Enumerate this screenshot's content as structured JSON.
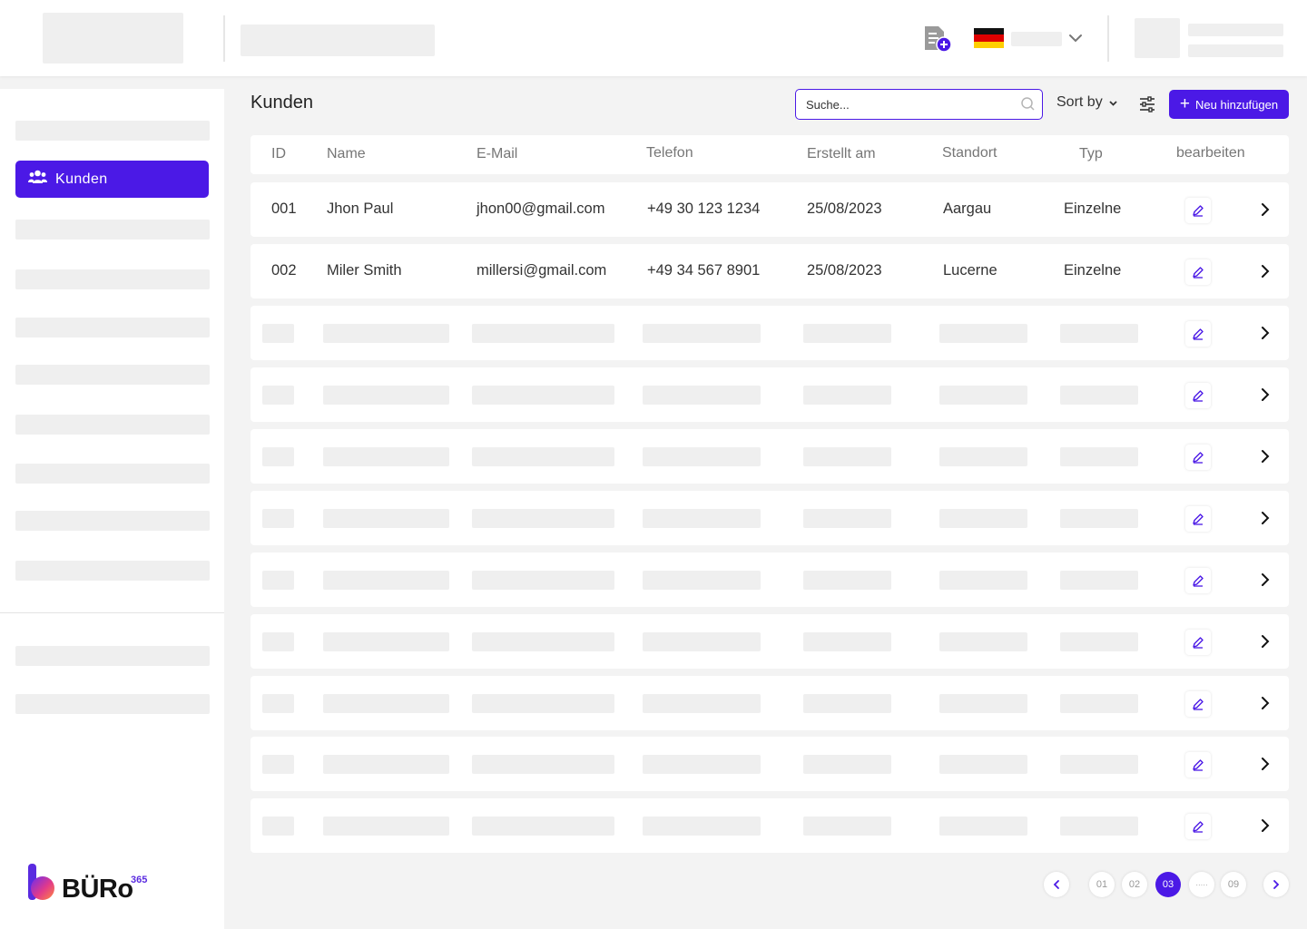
{
  "page": {
    "title": "Kunden"
  },
  "sidebar": {
    "active_item": {
      "label": "Kunden",
      "icon": "users-icon"
    }
  },
  "brand": {
    "logo_text": "BÜRo",
    "logo_suffix": "365",
    "accent": "#4b19e6"
  },
  "toolbar": {
    "search_placeholder": "Suche...",
    "sort_label": "Sort by",
    "add_label": "Neu hinzufügen"
  },
  "table": {
    "headers": [
      "ID",
      "Name",
      "E-Mail",
      "Telefon",
      "Erstellt am",
      "Standort",
      "Typ",
      "bearbeiten"
    ],
    "rows": [
      {
        "id": "001",
        "name": "Jhon Paul",
        "email": "jhon00@gmail.com",
        "phone": "+49 30 123 1234",
        "created": "25/08/2023",
        "location": "Aargau",
        "type": "Einzelne"
      },
      {
        "id": "002",
        "name": "Miler Smith",
        "email": "millersi@gmail.com",
        "phone": "+49 34 567 8901",
        "created": "25/08/2023",
        "location": "Lucerne",
        "type": "Einzelne"
      }
    ]
  },
  "pagination": {
    "pages": [
      "01",
      "02",
      "03",
      "·····",
      "09"
    ],
    "current": "03"
  }
}
